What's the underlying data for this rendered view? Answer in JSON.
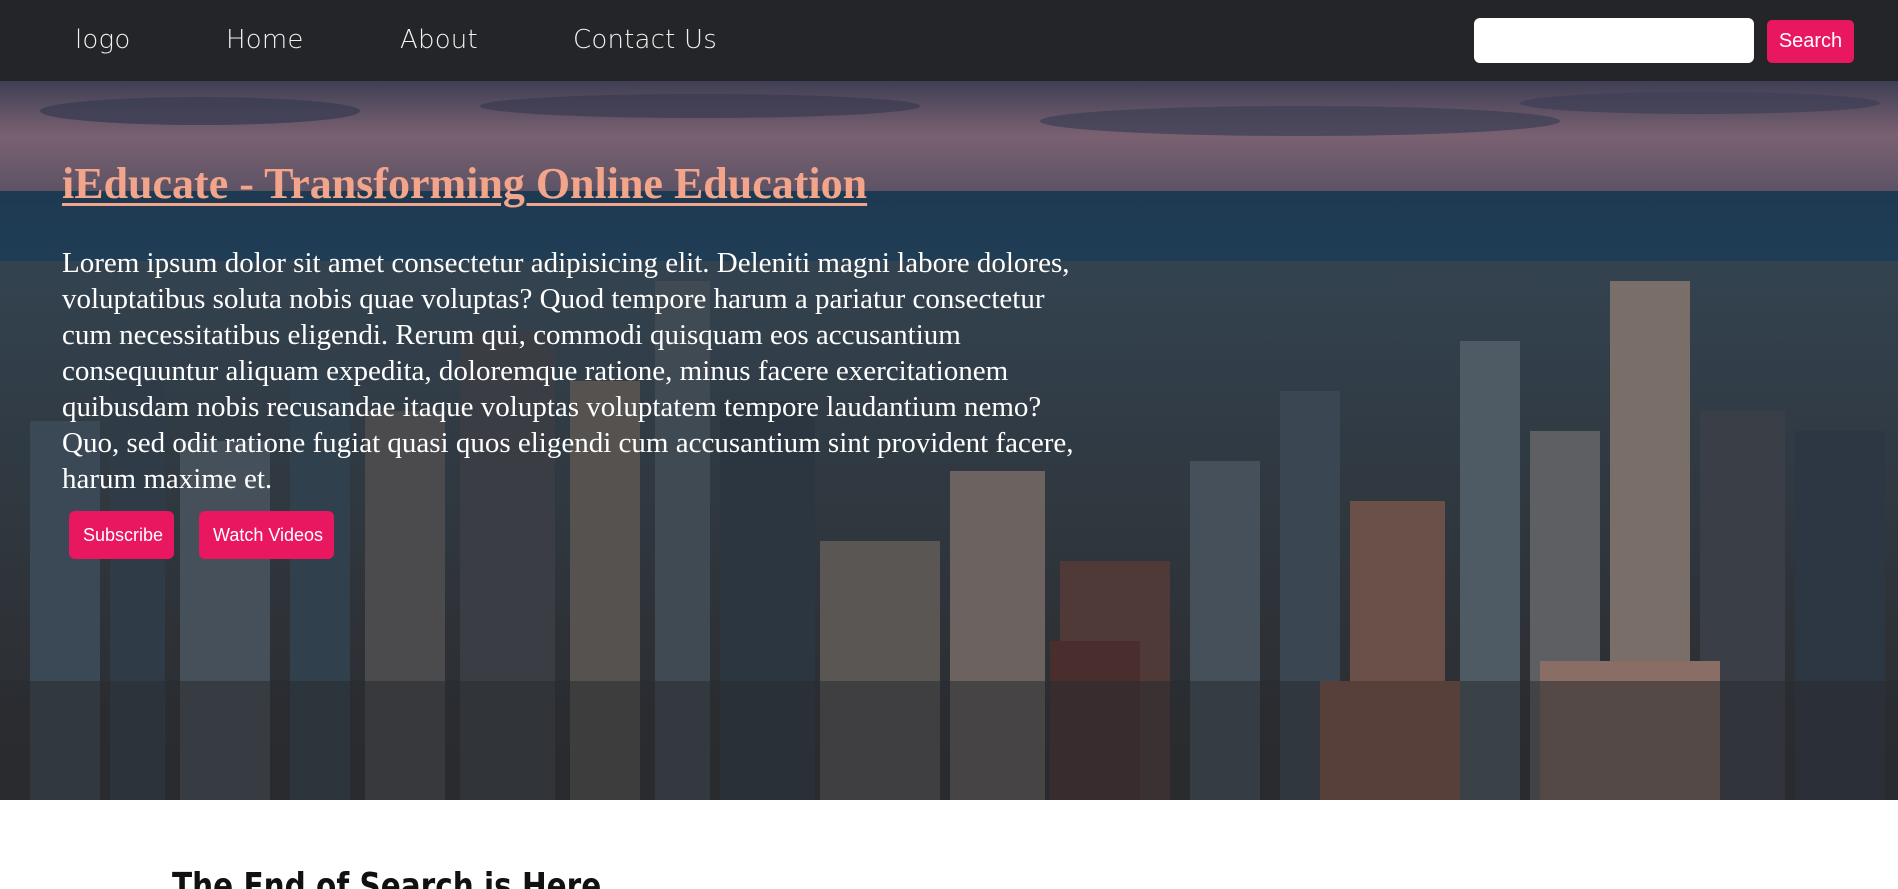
{
  "navbar": {
    "logo": "logo",
    "links": [
      "Home",
      "About",
      "Contact Us"
    ],
    "search": {
      "value": "",
      "placeholder": "",
      "button_label": "Search"
    },
    "colors": {
      "background": "#242529",
      "button": "#e8175f"
    }
  },
  "hero": {
    "title": "iEducate - Transforming Online Education",
    "description": "Lorem ipsum dolor sit amet consectetur adipisicing elit. Deleniti magni labore dolores, voluptatibus soluta nobis quae voluptas? Quod tempore harum a pariatur consectetur cum necessitatibus eligendi. Rerum qui, commodi quisquam eos accusantium consequuntur aliquam expedita, doloremque ratione, minus facere exercitationem quibusdam nobis recusandae itaque voluptas voluptatem tempore laudantium nemo? Quo, sed odit ratione fugiat quasi quos eligendi cum accusantium sint provident facere, harum maxime et.",
    "buttons": [
      "Subscribe",
      "Watch Videos"
    ],
    "background_icon": "city-skyline-photo",
    "colors": {
      "title": "#f2a58a",
      "button": "#e8175f"
    }
  },
  "section": {
    "heading": "The End of Search is Here"
  }
}
